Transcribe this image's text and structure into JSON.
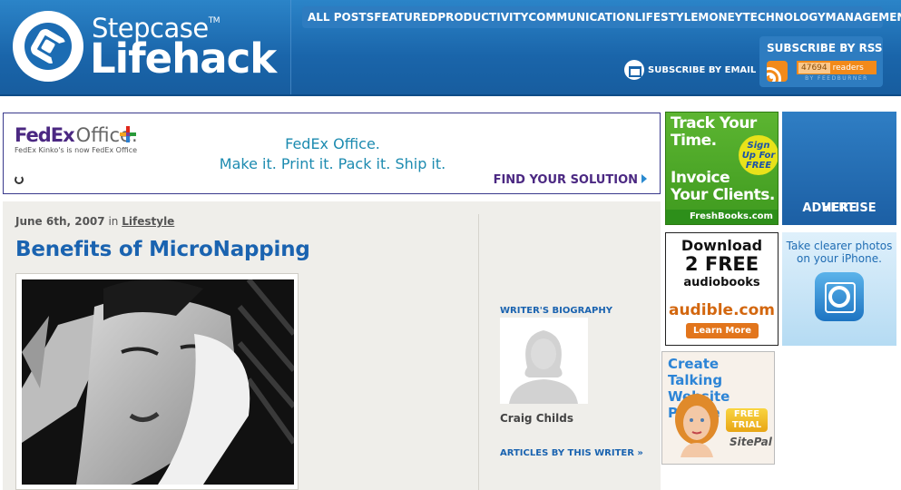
{
  "header": {
    "brand_top": "Stepcase",
    "brand_tm": "TM",
    "brand_main": "Lifehack",
    "nav": [
      "ALL POSTS",
      "FEATURED",
      "PRODUCTIVITY",
      "COMMUNICATION",
      "LIFESTYLE",
      "MONEY",
      "TECHNOLOGY",
      "MANAGEMENT"
    ],
    "subscribe_email": "SUBSCRIBE BY EMAIL",
    "rss_title": "SUBSCRIBE BY RSS",
    "feed_count": "47694",
    "feed_readers": "readers",
    "feed_by": "BY FEEDBURNER"
  },
  "fedex_ad": {
    "logo_fed": "Fed",
    "logo_ex": "Ex",
    "logo_office": "Office.",
    "sub": "FedEx Kinko's is now FedEx Office",
    "line1": "FedEx Office.",
    "line2": "Make it. Print it. Pack it. Ship it.",
    "cta": "FIND YOUR SOLUTION"
  },
  "post": {
    "date": "June 6th, 2007",
    "in": "in",
    "category": "Lifestyle",
    "title": "Benefits of MicroNapping",
    "bio_label": "WRITER'S BIOGRAPHY",
    "author": "Craig Childs",
    "articles_link": "ARTICLES BY THIS WRITER »"
  },
  "sidebar_ads": {
    "freshbooks": {
      "line1": "Track Your",
      "line2": "Time.",
      "line3": "Invoice",
      "line4": "Your Clients.",
      "burst": [
        "Sign",
        "Up For",
        "FREE"
      ],
      "foot": "FreshBooks.com"
    },
    "advertise": [
      "ADVERTISE",
      "HERE"
    ],
    "audible": {
      "l1": "Download",
      "l2": "2 FREE",
      "l3": "audiobooks",
      "logo": "audible.com",
      "btn": "Learn More"
    },
    "iphone": [
      "Take clearer photos",
      "on your iPhone."
    ],
    "sitepal": {
      "t1": "Create Talking",
      "t2": "Website People",
      "badge1": "FREE",
      "badge2": "TRIAL",
      "brand": "SitePal"
    }
  },
  "colors": {
    "header_blue": "#1a65aa",
    "link_blue": "#1a63b0",
    "fedex_purple": "#4b2882",
    "rss_orange": "#f28a1a"
  }
}
